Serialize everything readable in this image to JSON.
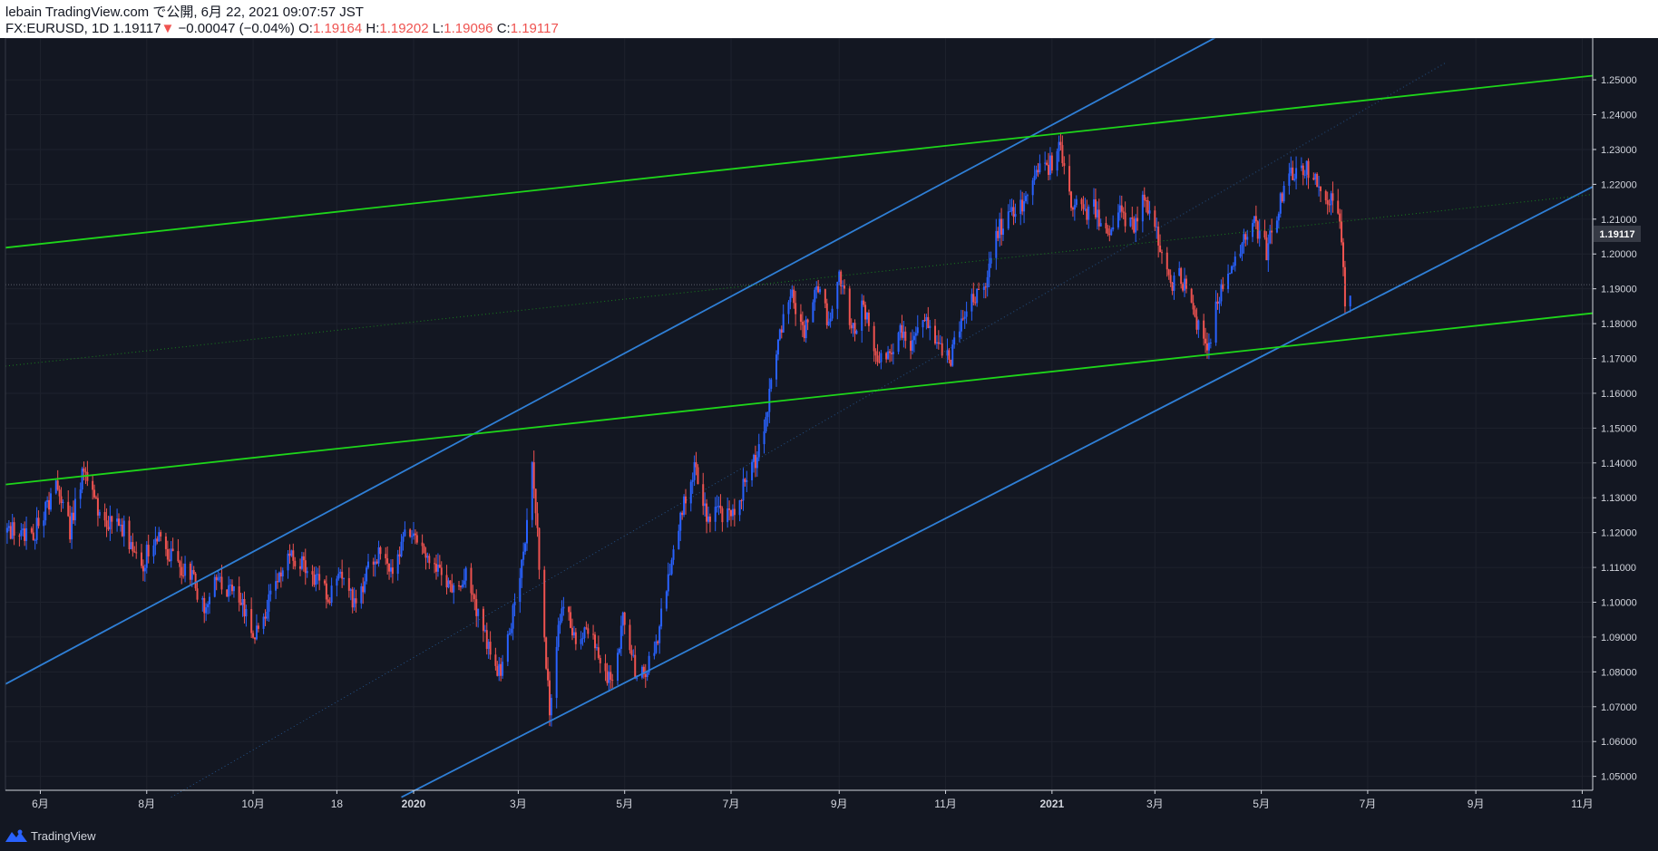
{
  "header": {
    "publish_line": "lebain TradingView.com で公開, 6月 22, 2021 09:07:57 JST",
    "symbol": "FX:EURUSD, 1D",
    "last": "1.19117",
    "change_arrow": "▼",
    "change": "−0.00047 (−0.04%)",
    "o_label": "O:",
    "o_value": "1.19164",
    "h_label": "H:",
    "h_value": "1.19202",
    "l_label": "L:",
    "l_value": "1.19096",
    "c_label": "C:",
    "c_value": "1.19117"
  },
  "footer": {
    "brand": "TradingView",
    "logo_icon": "tradingview-logo-icon"
  },
  "colors": {
    "background": "#131722",
    "grid": "#1e222d",
    "up": "#2962ff",
    "down": "#ef5350",
    "channel_blue": "#2f7fd6",
    "channel_green": "#1ed61a",
    "axis_text": "#d1d4dc",
    "price_tag": "#363a45"
  },
  "chart_data": {
    "type": "candlestick",
    "symbol": "FX:EURUSD",
    "interval": "1D",
    "y_ticks": [
      "1.25000",
      "1.24000",
      "1.23000",
      "1.22000",
      "1.21000",
      "1.20000",
      "1.19000",
      "1.18000",
      "1.17000",
      "1.16000",
      "1.15000",
      "1.14000",
      "1.13000",
      "1.12000",
      "1.11000",
      "1.10000",
      "1.09000",
      "1.08000",
      "1.07000",
      "1.06000",
      "1.05000"
    ],
    "ylim": [
      1.046,
      1.262
    ],
    "x_ticks": [
      {
        "label": "6月",
        "date": "2019-06-01"
      },
      {
        "label": "8月",
        "date": "2019-08-01"
      },
      {
        "label": "10月",
        "date": "2019-10-01"
      },
      {
        "label": "18",
        "date": "2019-11-18"
      },
      {
        "label": "2020",
        "date": "2020-01-01"
      },
      {
        "label": "3月",
        "date": "2020-03-01"
      },
      {
        "label": "5月",
        "date": "2020-05-01"
      },
      {
        "label": "7月",
        "date": "2020-07-01"
      },
      {
        "label": "9月",
        "date": "2020-09-01"
      },
      {
        "label": "11月",
        "date": "2020-11-01"
      },
      {
        "label": "2021",
        "date": "2021-01-01"
      },
      {
        "label": "3月",
        "date": "2021-03-01"
      },
      {
        "label": "5月",
        "date": "2021-05-01"
      },
      {
        "label": "7月",
        "date": "2021-07-01"
      },
      {
        "label": "9月",
        "date": "2021-09-01"
      },
      {
        "label": "11月",
        "date": "2021-11-01"
      }
    ],
    "xlim": [
      "2019-05-12",
      "2021-11-07"
    ],
    "last_price": "1.19117",
    "price_path": [
      [
        "2019-05-13",
        1.12
      ],
      [
        "2019-05-20",
        1.121
      ],
      [
        "2019-05-27",
        1.118
      ],
      [
        "2019-06-04",
        1.127
      ],
      [
        "2019-06-10",
        1.132
      ],
      [
        "2019-06-18",
        1.121
      ],
      [
        "2019-06-25",
        1.137
      ],
      [
        "2019-07-01",
        1.131
      ],
      [
        "2019-07-08",
        1.122
      ],
      [
        "2019-07-15",
        1.125
      ],
      [
        "2019-07-22",
        1.117
      ],
      [
        "2019-07-29",
        1.11
      ],
      [
        "2019-08-06",
        1.12
      ],
      [
        "2019-08-12",
        1.115
      ],
      [
        "2019-08-20",
        1.109
      ],
      [
        "2019-08-27",
        1.107
      ],
      [
        "2019-09-03",
        1.098
      ],
      [
        "2019-09-10",
        1.106
      ],
      [
        "2019-09-18",
        1.104
      ],
      [
        "2019-09-25",
        1.098
      ],
      [
        "2019-10-01",
        1.09
      ],
      [
        "2019-10-08",
        1.098
      ],
      [
        "2019-10-15",
        1.105
      ],
      [
        "2019-10-22",
        1.114
      ],
      [
        "2019-10-30",
        1.112
      ],
      [
        "2019-11-06",
        1.106
      ],
      [
        "2019-11-13",
        1.102
      ],
      [
        "2019-11-21",
        1.107
      ],
      [
        "2019-11-28",
        1.1
      ],
      [
        "2019-12-05",
        1.108
      ],
      [
        "2019-12-12",
        1.114
      ],
      [
        "2019-12-19",
        1.11
      ],
      [
        "2019-12-27",
        1.119
      ],
      [
        "2020-01-03",
        1.116
      ],
      [
        "2020-01-10",
        1.112
      ],
      [
        "2020-01-17",
        1.109
      ],
      [
        "2020-01-24",
        1.103
      ],
      [
        "2020-01-31",
        1.108
      ],
      [
        "2020-02-07",
        1.096
      ],
      [
        "2020-02-14",
        1.084
      ],
      [
        "2020-02-20",
        1.079
      ],
      [
        "2020-02-27",
        1.097
      ],
      [
        "2020-03-04",
        1.114
      ],
      [
        "2020-03-09",
        1.142
      ],
      [
        "2020-03-13",
        1.111
      ],
      [
        "2020-03-19",
        1.069
      ],
      [
        "2020-03-26",
        1.1
      ],
      [
        "2020-04-02",
        1.09
      ],
      [
        "2020-04-09",
        1.093
      ],
      [
        "2020-04-16",
        1.086
      ],
      [
        "2020-04-23",
        1.076
      ],
      [
        "2020-04-30",
        1.095
      ],
      [
        "2020-05-07",
        1.08
      ],
      [
        "2020-05-14",
        1.08
      ],
      [
        "2020-05-21",
        1.093
      ],
      [
        "2020-05-28",
        1.11
      ],
      [
        "2020-06-04",
        1.13
      ],
      [
        "2020-06-10",
        1.138
      ],
      [
        "2020-06-17",
        1.125
      ],
      [
        "2020-06-24",
        1.126
      ],
      [
        "2020-07-01",
        1.124
      ],
      [
        "2020-07-08",
        1.133
      ],
      [
        "2020-07-15",
        1.141
      ],
      [
        "2020-07-22",
        1.156
      ],
      [
        "2020-07-29",
        1.178
      ],
      [
        "2020-08-05",
        1.188
      ],
      [
        "2020-08-12",
        1.178
      ],
      [
        "2020-08-19",
        1.19
      ],
      [
        "2020-08-26",
        1.18
      ],
      [
        "2020-09-01",
        1.195
      ],
      [
        "2020-09-08",
        1.177
      ],
      [
        "2020-09-15",
        1.185
      ],
      [
        "2020-09-22",
        1.17
      ],
      [
        "2020-09-29",
        1.173
      ],
      [
        "2020-10-06",
        1.177
      ],
      [
        "2020-10-13",
        1.174
      ],
      [
        "2020-10-20",
        1.182
      ],
      [
        "2020-10-27",
        1.175
      ],
      [
        "2020-11-04",
        1.169
      ],
      [
        "2020-11-10",
        1.183
      ],
      [
        "2020-11-17",
        1.186
      ],
      [
        "2020-11-24",
        1.192
      ],
      [
        "2020-12-01",
        1.207
      ],
      [
        "2020-12-08",
        1.212
      ],
      [
        "2020-12-15",
        1.214
      ],
      [
        "2020-12-22",
        1.224
      ],
      [
        "2020-12-29",
        1.225
      ],
      [
        "2021-01-06",
        1.23
      ],
      [
        "2021-01-12",
        1.216
      ],
      [
        "2021-01-19",
        1.211
      ],
      [
        "2021-01-26",
        1.213
      ],
      [
        "2021-02-02",
        1.205
      ],
      [
        "2021-02-09",
        1.212
      ],
      [
        "2021-02-16",
        1.208
      ],
      [
        "2021-02-23",
        1.216
      ],
      [
        "2021-03-02",
        1.207
      ],
      [
        "2021-03-09",
        1.191
      ],
      [
        "2021-03-16",
        1.194
      ],
      [
        "2021-03-23",
        1.183
      ],
      [
        "2021-03-31",
        1.172
      ],
      [
        "2021-04-06",
        1.188
      ],
      [
        "2021-04-13",
        1.196
      ],
      [
        "2021-04-20",
        1.203
      ],
      [
        "2021-04-27",
        1.209
      ],
      [
        "2021-05-04",
        1.201
      ],
      [
        "2021-05-11",
        1.214
      ],
      [
        "2021-05-18",
        1.222
      ],
      [
        "2021-05-25",
        1.225
      ],
      [
        "2021-06-01",
        1.222
      ],
      [
        "2021-06-08",
        1.217
      ],
      [
        "2021-06-15",
        1.212
      ],
      [
        "2021-06-18",
        1.187
      ],
      [
        "2021-06-21",
        1.191
      ]
    ],
    "trendlines": [
      {
        "color": "blue",
        "from": [
          "2019-05-12",
          1.0765
        ],
        "to": [
          "2021-11-07",
          1.32
        ]
      },
      {
        "color": "blue",
        "from": [
          "2019-12-25",
          1.044
        ],
        "to": [
          "2021-11-07",
          1.2193
        ]
      },
      {
        "color": "blue",
        "style": "dotted",
        "from": [
          "2019-08-15",
          1.044
        ],
        "to": [
          "2021-08-15",
          1.255
        ]
      },
      {
        "color": "green",
        "from": [
          "2019-05-12",
          1.2018
        ],
        "to": [
          "2021-11-07",
          1.2512
        ]
      },
      {
        "color": "green",
        "from": [
          "2019-05-12",
          1.1338
        ],
        "to": [
          "2021-11-07",
          1.183
        ]
      },
      {
        "color": "green",
        "style": "dotted",
        "from": [
          "2019-05-12",
          1.1678
        ],
        "to": [
          "2021-11-07",
          1.2171
        ]
      }
    ]
  }
}
